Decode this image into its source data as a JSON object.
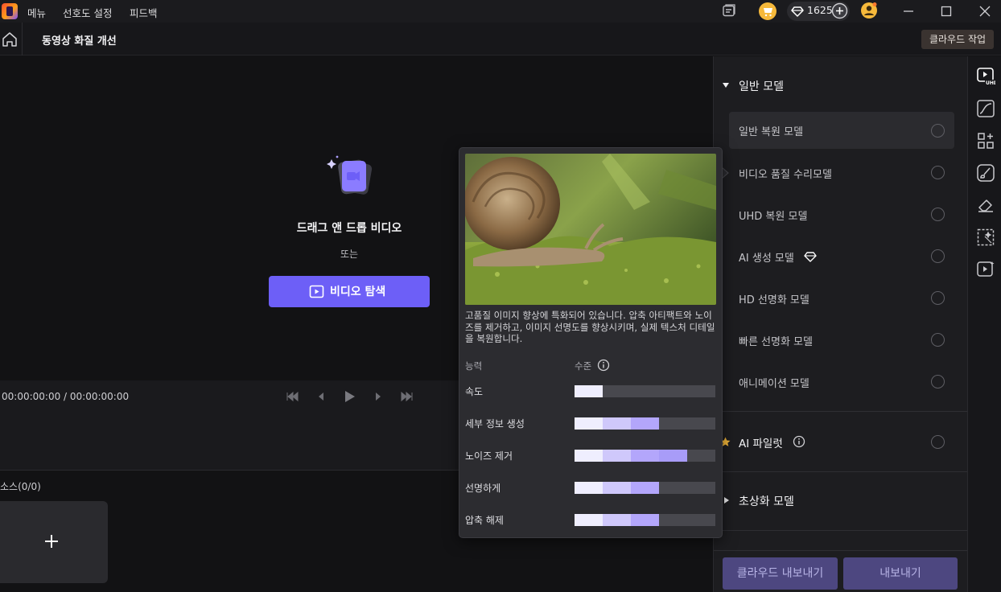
{
  "menu": {
    "items": [
      "메뉴",
      "선호도 설정",
      "피드백"
    ]
  },
  "credits": {
    "count": "1625"
  },
  "header": {
    "title": "동영상 화질 개선",
    "cloud_task": "클라우드 작업"
  },
  "preview": {
    "drop_title": "드래그 앤 드롭 비디오",
    "or": "또는",
    "browse_button": "비디오 탐색"
  },
  "player": {
    "timecode": "00:00:00:00 / 00:00:00:00"
  },
  "media": {
    "label": "소스(0/0)"
  },
  "popup": {
    "description": "고품질 이미지 향상에 특화되어 있습니다. 압축 아티팩트와 노이즈를 제거하고, 이미지 선명도를 향상시키며, 실제 텍스처 디테일을 복원합니다.",
    "capability_header": "능력",
    "level_header": "수준",
    "capabilities": [
      {
        "label": "속도",
        "level": 1
      },
      {
        "label": "세부 정보 생성",
        "level": 3
      },
      {
        "label": "노이즈 제거",
        "level": 4
      },
      {
        "label": "선명하게",
        "level": 3
      },
      {
        "label": "압축 해제",
        "level": 3
      }
    ],
    "level_max": 5
  },
  "panel": {
    "general_section": "일반 모델",
    "models": [
      {
        "label": "일반 복원 모델",
        "selected": true
      },
      {
        "label": "비디오 품질 수리모델",
        "selected": false
      },
      {
        "label": "UHD 복원 모델",
        "selected": false
      },
      {
        "label": "AI 생성 모델",
        "selected": false,
        "premium": true
      },
      {
        "label": "HD 선명화 모델",
        "selected": false
      },
      {
        "label": "빠른 선명화 모델",
        "selected": false
      },
      {
        "label": "애니메이션 모델",
        "selected": false
      }
    ],
    "ai_pilot": "AI 파일럿",
    "super_res_section": "초상화 모델",
    "export_cloud": "클라우드 내보내기",
    "export": "내보내기"
  },
  "colors": {
    "accent": "#6d5ff7",
    "seg_light": "#efeefe",
    "seg_mid": "#cfc8fb",
    "seg_strong": "#b3a6fb",
    "seg_deep": "#a89cf8"
  },
  "icons": [
    "app-logo",
    "feedback-icon",
    "cart-icon",
    "diamond-icon",
    "plus-circle-icon",
    "avatar-icon",
    "minimize-icon",
    "maximize-icon",
    "close-icon",
    "home-icon",
    "upload-video-icon",
    "play-square-icon",
    "skip-back-icon",
    "prev-frame-icon",
    "play-icon",
    "next-frame-icon",
    "skip-forward-icon",
    "info-icon",
    "star-icon",
    "uhd-tool-icon",
    "curve-tool-icon",
    "grid-plus-tool-icon",
    "brush-tool-icon",
    "eraser-tool-icon",
    "magic-select-tool-icon",
    "video-enhance-tool-icon"
  ]
}
